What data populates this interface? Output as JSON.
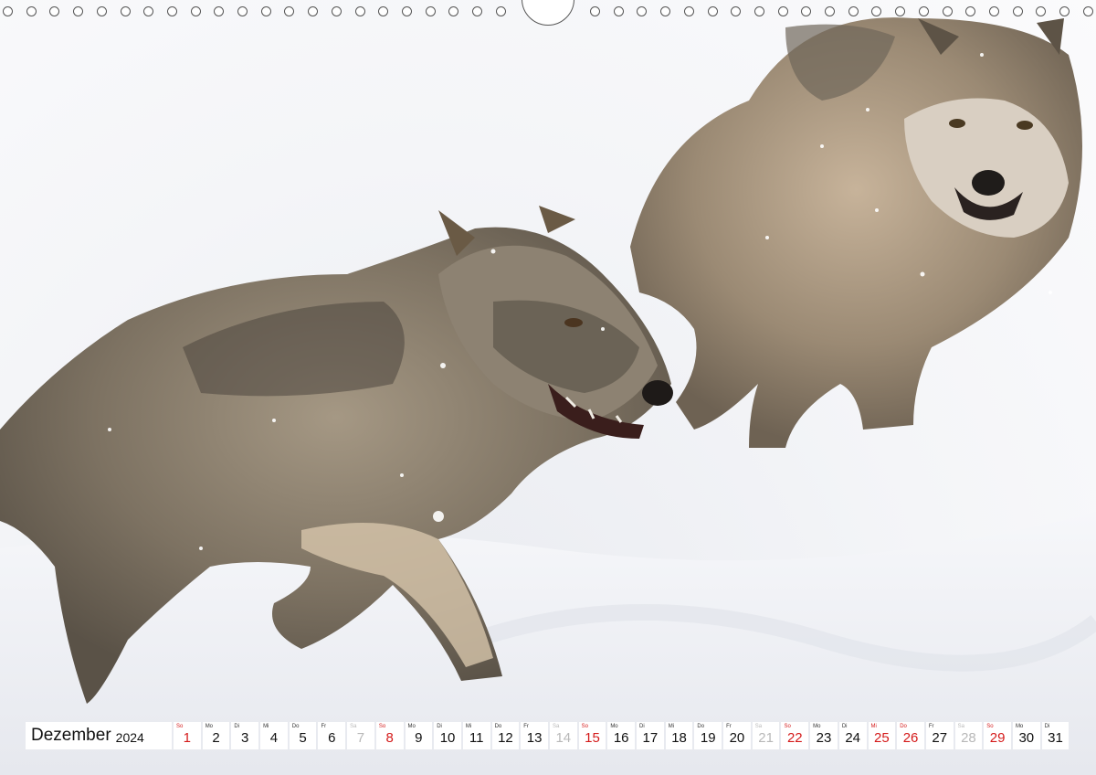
{
  "calendar": {
    "month": "Dezember",
    "year": "2024",
    "days": [
      {
        "dow": "So",
        "num": "1",
        "type": "sun"
      },
      {
        "dow": "Mo",
        "num": "2",
        "type": "work"
      },
      {
        "dow": "Di",
        "num": "3",
        "type": "work"
      },
      {
        "dow": "Mi",
        "num": "4",
        "type": "work"
      },
      {
        "dow": "Do",
        "num": "5",
        "type": "work"
      },
      {
        "dow": "Fr",
        "num": "6",
        "type": "work"
      },
      {
        "dow": "Sa",
        "num": "7",
        "type": "sat"
      },
      {
        "dow": "So",
        "num": "8",
        "type": "sun"
      },
      {
        "dow": "Mo",
        "num": "9",
        "type": "work"
      },
      {
        "dow": "Di",
        "num": "10",
        "type": "work"
      },
      {
        "dow": "Mi",
        "num": "11",
        "type": "work"
      },
      {
        "dow": "Do",
        "num": "12",
        "type": "work"
      },
      {
        "dow": "Fr",
        "num": "13",
        "type": "work"
      },
      {
        "dow": "Sa",
        "num": "14",
        "type": "sat"
      },
      {
        "dow": "So",
        "num": "15",
        "type": "sun"
      },
      {
        "dow": "Mo",
        "num": "16",
        "type": "work"
      },
      {
        "dow": "Di",
        "num": "17",
        "type": "work"
      },
      {
        "dow": "Mi",
        "num": "18",
        "type": "work"
      },
      {
        "dow": "Do",
        "num": "19",
        "type": "work"
      },
      {
        "dow": "Fr",
        "num": "20",
        "type": "work"
      },
      {
        "dow": "Sa",
        "num": "21",
        "type": "sat"
      },
      {
        "dow": "So",
        "num": "22",
        "type": "sun"
      },
      {
        "dow": "Mo",
        "num": "23",
        "type": "work"
      },
      {
        "dow": "Di",
        "num": "24",
        "type": "work"
      },
      {
        "dow": "Mi",
        "num": "25",
        "type": "hol"
      },
      {
        "dow": "Do",
        "num": "26",
        "type": "hol"
      },
      {
        "dow": "Fr",
        "num": "27",
        "type": "work"
      },
      {
        "dow": "Sa",
        "num": "28",
        "type": "sat"
      },
      {
        "dow": "So",
        "num": "29",
        "type": "sun"
      },
      {
        "dow": "Mo",
        "num": "30",
        "type": "work"
      },
      {
        "dow": "Di",
        "num": "31",
        "type": "work"
      }
    ]
  },
  "colors": {
    "sunday_holiday": "#d41a1a",
    "saturday": "#b8b8b8",
    "weekday": "#111111"
  },
  "photo": {
    "subject_icon": "wolf-pair-in-snow"
  }
}
